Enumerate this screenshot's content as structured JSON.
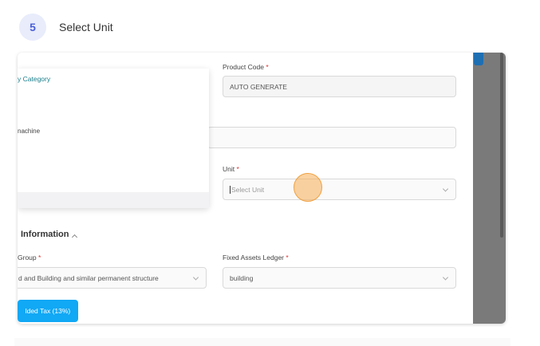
{
  "step": {
    "number": "5",
    "title": "Select Unit"
  },
  "form": {
    "product_code_label": "Product Code",
    "product_code_value": "AUTO GENERATE",
    "unit_label": "Unit",
    "unit_placeholder": "Select Unit",
    "required_marker": "*"
  },
  "dropdown": {
    "header": "y Category",
    "items": [
      "nachine"
    ]
  },
  "section": {
    "title": "Information"
  },
  "group": {
    "label": "Group",
    "value": "d and Building and similar permanent structure"
  },
  "ledger": {
    "label": "Fixed Assets Ledger",
    "value": "building"
  },
  "tax_button": "lded Tax (13%)",
  "colors": {
    "accent": "#11a8f5",
    "badge_bg": "#e8ecfb",
    "required": "#e03131",
    "cursor": "#f0a040"
  }
}
